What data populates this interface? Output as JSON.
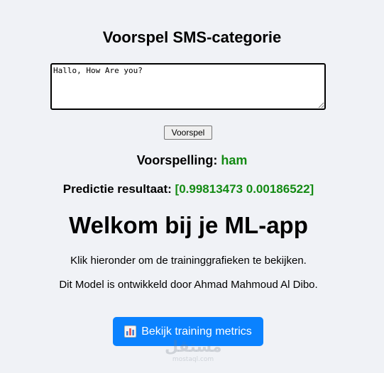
{
  "form": {
    "title": "Voorspel SMS-categorie",
    "message_value": "Hallo, How Are you?",
    "submit_label": "Voorspel"
  },
  "prediction": {
    "label": "Voorspelling:",
    "value": "ham",
    "result_label": "Predictie resultaat:",
    "result_value": "[0.99813473 0.00186522]",
    "value_color": "#138a13"
  },
  "welcome": {
    "heading": "Welkom bij je ML-app",
    "instruction": "Klik hieronder om de traininggrafieken te bekijken.",
    "credit": "Dit Model is ontwikkeld door Ahmad Mahmoud Al Dibo."
  },
  "metrics_button": {
    "icon": "bar-chart-icon",
    "label": "Bekijk training metrics",
    "color": "#0a82ff"
  },
  "watermark": {
    "arabic": "مستقل",
    "latin": "mostaql.com"
  }
}
